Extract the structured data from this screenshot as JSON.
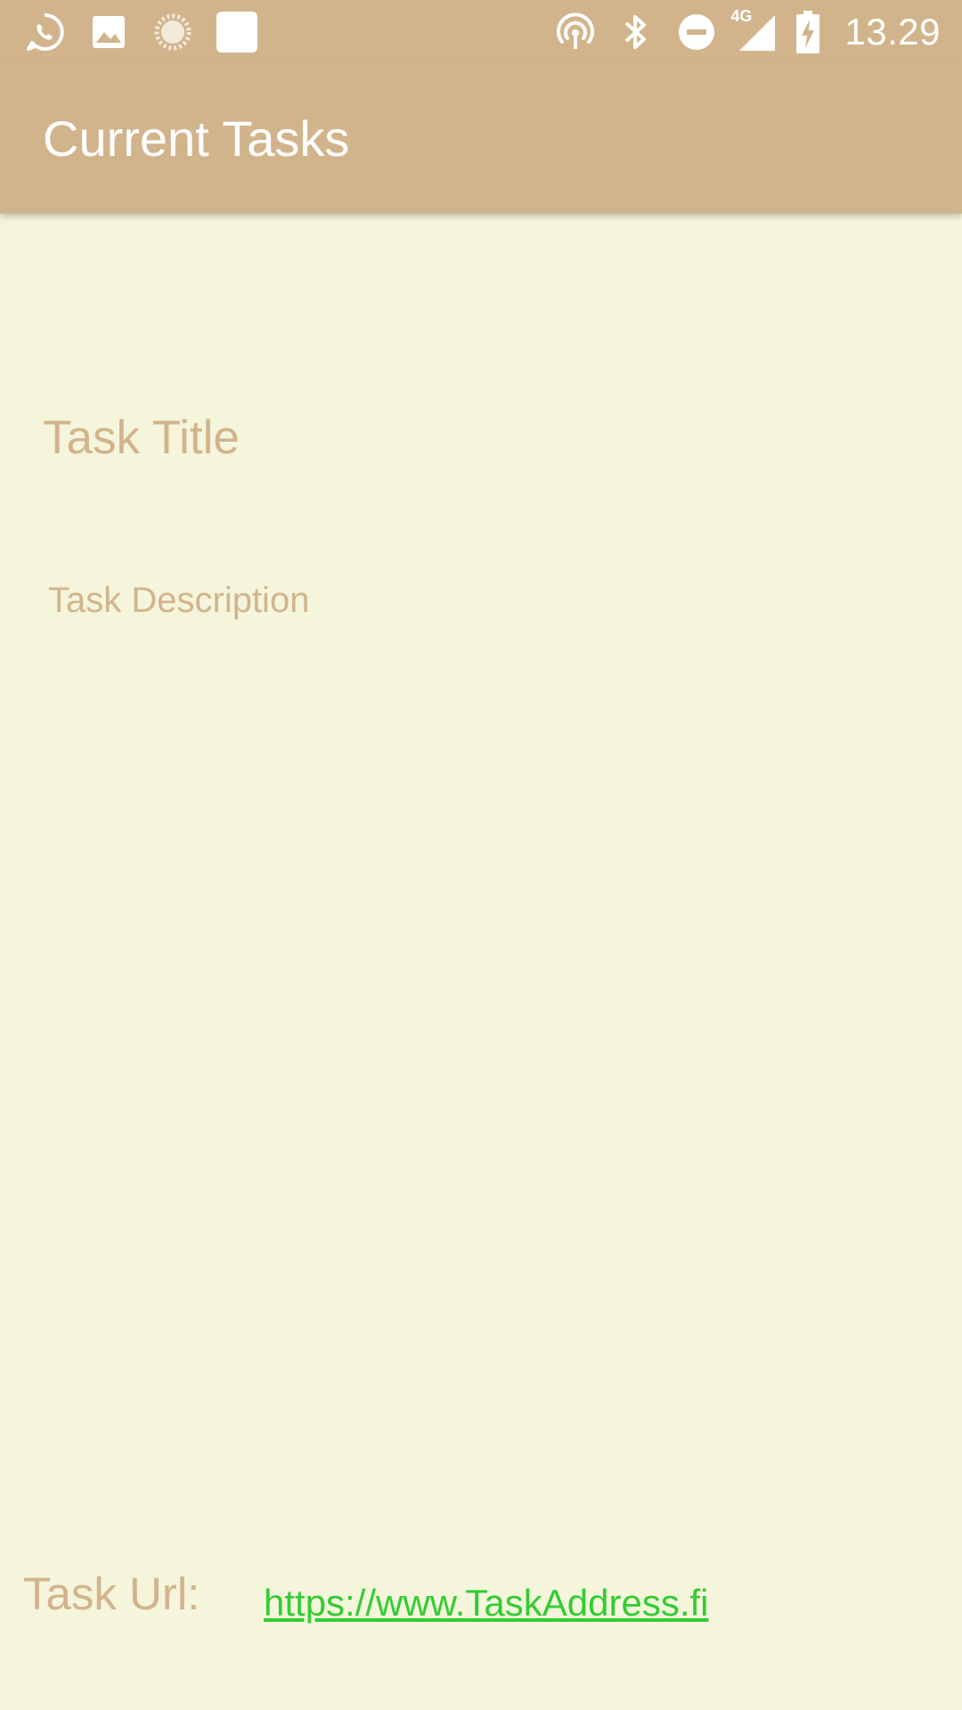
{
  "status_bar": {
    "left_icons": [
      "whatsapp-icon",
      "image-icon",
      "loading-icon",
      "square-icon"
    ],
    "right_icons": [
      "hotspot-icon",
      "bluetooth-icon",
      "do-not-disturb-icon",
      "signal-4g-icon",
      "battery-charging-icon"
    ],
    "network_label": "4G",
    "time": "13.29"
  },
  "app_bar": {
    "title": "Current Tasks"
  },
  "task": {
    "title": "Task Title",
    "description": "Task Description",
    "url_label": "Task Url:",
    "url_value": "https://www.TaskAddress.fi"
  },
  "colors": {
    "bar": "#D2B48C",
    "background": "#F5F5DC",
    "link": "#32CD32"
  }
}
